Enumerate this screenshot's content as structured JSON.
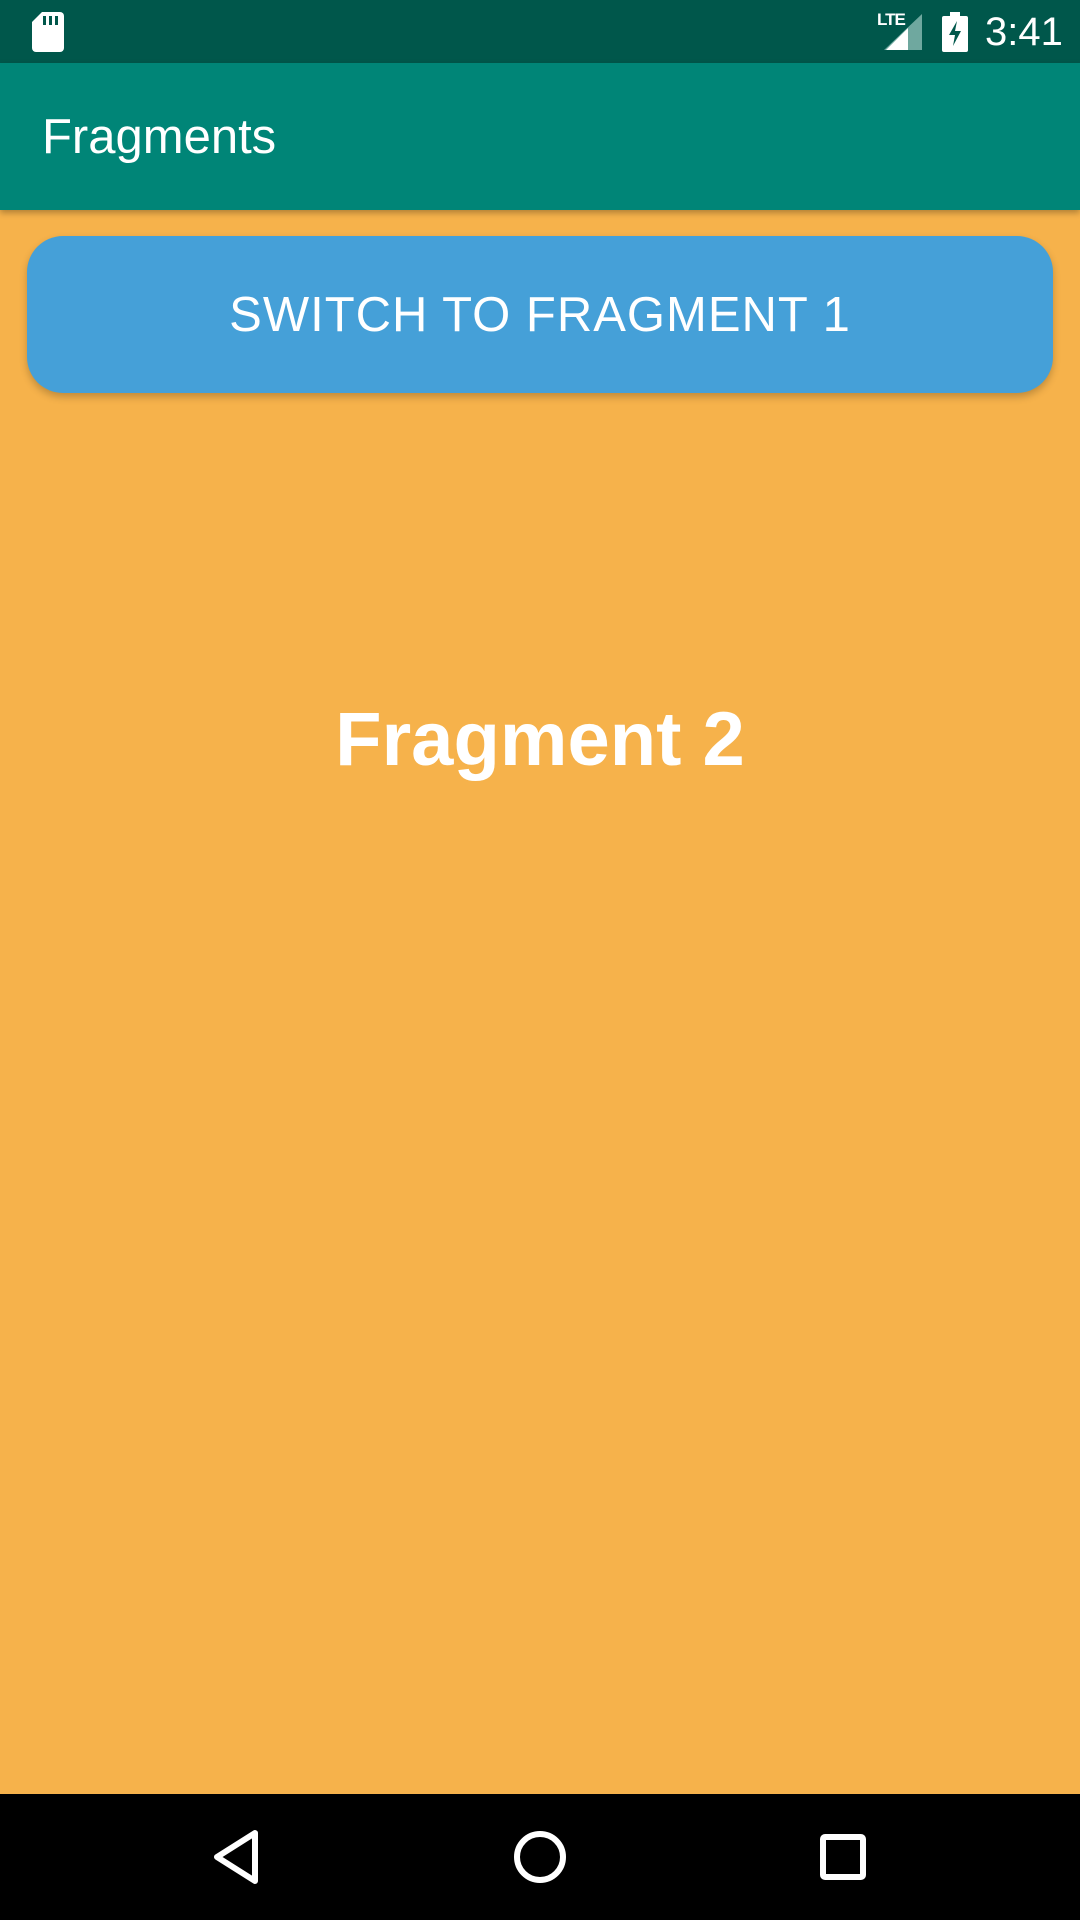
{
  "status_bar": {
    "time": "3:41",
    "network_label": "LTE",
    "icons": [
      "sd-card-icon",
      "signal-icon",
      "battery-charging-icon"
    ]
  },
  "app_bar": {
    "title": "Fragments",
    "color": "#008577"
  },
  "main": {
    "button_label": "SWITCH TO FRAGMENT 1",
    "button_color": "#45A0D8",
    "fragment_title": "Fragment 2",
    "background_color": "#F6B24B"
  },
  "nav_bar": {
    "icons": [
      "back-icon",
      "home-icon",
      "recents-icon"
    ]
  }
}
